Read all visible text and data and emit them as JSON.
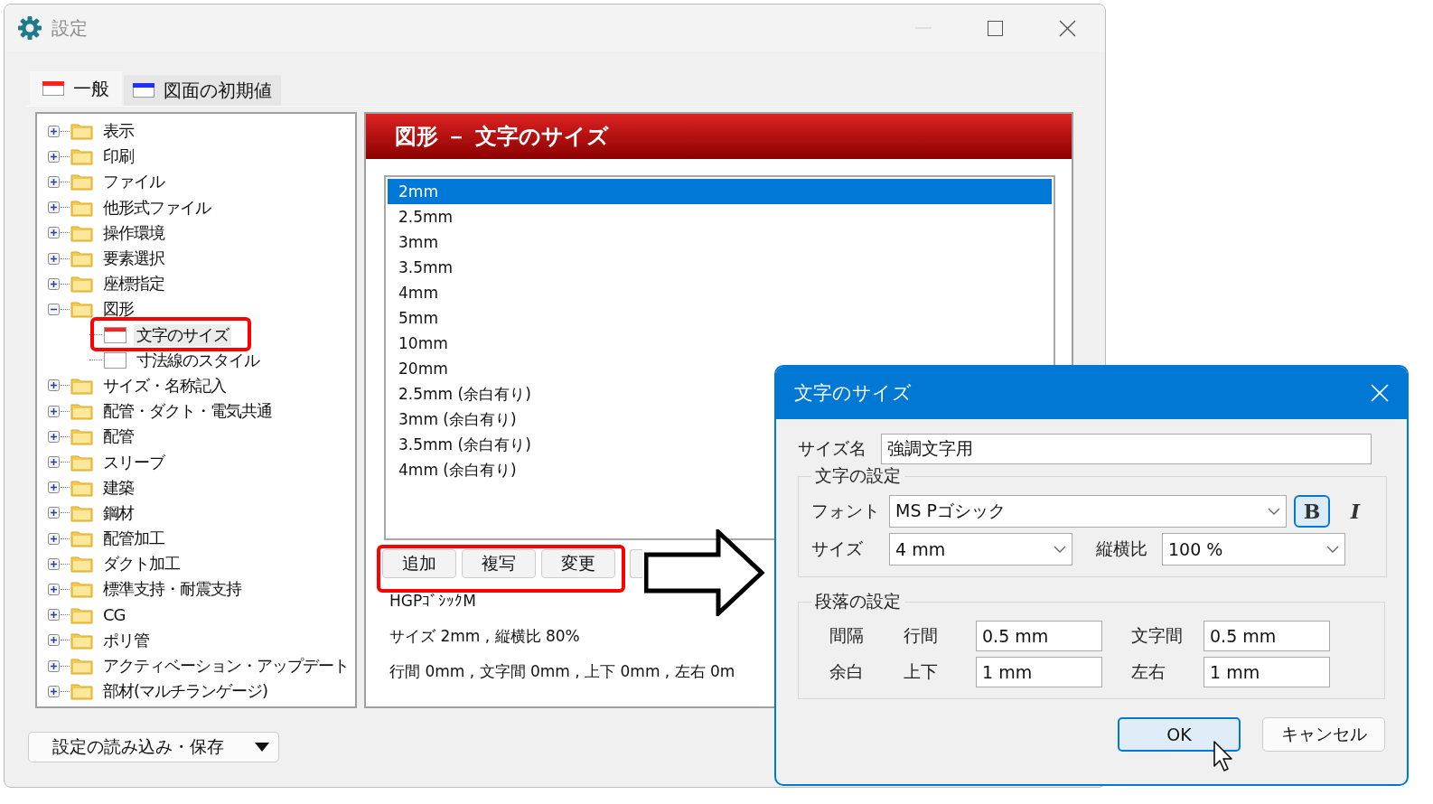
{
  "window": {
    "title": "設定"
  },
  "tabs": [
    {
      "label": "一般",
      "selected": true,
      "color": "#ff2020"
    },
    {
      "label": "図面の初期値",
      "selected": false,
      "color": "#2030ff"
    }
  ],
  "tree": [
    {
      "label": "表示",
      "kind": "folder",
      "expanded": false,
      "selected": false
    },
    {
      "label": "印刷",
      "kind": "folder",
      "expanded": false,
      "selected": false
    },
    {
      "label": "ファイル",
      "kind": "folder",
      "expanded": false,
      "selected": false
    },
    {
      "label": "他形式ファイル",
      "kind": "folder",
      "expanded": false,
      "selected": false
    },
    {
      "label": "操作環境",
      "kind": "folder",
      "expanded": false,
      "selected": false
    },
    {
      "label": "要素選択",
      "kind": "folder",
      "expanded": false,
      "selected": false
    },
    {
      "label": "座標指定",
      "kind": "folder",
      "expanded": false,
      "selected": false
    },
    {
      "label": "図形",
      "kind": "folder",
      "expanded": true,
      "selected": false,
      "children": [
        {
          "label": "文字のサイズ",
          "kind": "page",
          "selected": true
        },
        {
          "label": "寸法線のスタイル",
          "kind": "page",
          "selected": false
        }
      ]
    },
    {
      "label": "サイズ・名称記入",
      "kind": "folder",
      "expanded": false,
      "selected": false
    },
    {
      "label": "配管・ダクト・電気共通",
      "kind": "folder",
      "expanded": false,
      "selected": false
    },
    {
      "label": "配管",
      "kind": "folder",
      "expanded": false,
      "selected": false
    },
    {
      "label": "スリーブ",
      "kind": "folder",
      "expanded": false,
      "selected": false
    },
    {
      "label": "建築",
      "kind": "folder",
      "expanded": false,
      "selected": false
    },
    {
      "label": "鋼材",
      "kind": "folder",
      "expanded": false,
      "selected": false
    },
    {
      "label": "配管加工",
      "kind": "folder",
      "expanded": false,
      "selected": false
    },
    {
      "label": "ダクト加工",
      "kind": "folder",
      "expanded": false,
      "selected": false
    },
    {
      "label": "標準支持・耐震支持",
      "kind": "folder",
      "expanded": false,
      "selected": false
    },
    {
      "label": "CG",
      "kind": "folder",
      "expanded": false,
      "selected": false
    },
    {
      "label": "ポリ管",
      "kind": "folder",
      "expanded": false,
      "selected": false
    },
    {
      "label": "アクティベーション・アップデート",
      "kind": "folder",
      "expanded": false,
      "selected": false
    },
    {
      "label": "部材(マルチランゲージ)",
      "kind": "folder",
      "expanded": false,
      "selected": false
    }
  ],
  "panel": {
    "title": "図形 － 文字のサイズ",
    "list": [
      {
        "label": "2mm",
        "selected": true
      },
      {
        "label": "2.5mm",
        "selected": false
      },
      {
        "label": "3mm",
        "selected": false
      },
      {
        "label": "3.5mm",
        "selected": false
      },
      {
        "label": "4mm",
        "selected": false
      },
      {
        "label": "5mm",
        "selected": false
      },
      {
        "label": "10mm",
        "selected": false
      },
      {
        "label": "20mm",
        "selected": false
      },
      {
        "label": "2.5mm (余白有り)",
        "selected": false
      },
      {
        "label": "3mm (余白有り)",
        "selected": false
      },
      {
        "label": "3.5mm (余白有り)",
        "selected": false
      },
      {
        "label": "4mm (余白有り)",
        "selected": false
      }
    ],
    "buttons": [
      "追加",
      "複写",
      "変更"
    ],
    "info": [
      "HGPｺﾞｼｯｸM",
      "サイズ 2mm , 縦横比 80%",
      "行間 0mm , 文字間 0mm , 上下 0mm , 左右 0m"
    ]
  },
  "load_save_button": "設定の読み込み・保存",
  "dialog": {
    "title": "文字のサイズ",
    "size_name": {
      "label": "サイズ名",
      "value": "強調文字用"
    },
    "text_group": {
      "title": "文字の設定",
      "font": {
        "label": "フォント",
        "value": "MS Pゴシック"
      },
      "bold": {
        "label": "B",
        "on": true
      },
      "italic": {
        "label": "I",
        "on": false
      },
      "size": {
        "label": "サイズ",
        "value": "4 mm"
      },
      "aspect": {
        "label": "縦横比",
        "value": "100 %"
      }
    },
    "para_group": {
      "title": "段落の設定",
      "rows": [
        {
          "label": "間隔",
          "fields": [
            {
              "label": "行間",
              "value": "0.5 mm"
            },
            {
              "label": "文字間",
              "value": "0.5 mm"
            }
          ]
        },
        {
          "label": "余白",
          "fields": [
            {
              "label": "上下",
              "value": "1 mm"
            },
            {
              "label": "左右",
              "value": "1 mm"
            }
          ]
        }
      ]
    },
    "buttons": [
      {
        "label": "OK",
        "default": true
      },
      {
        "label": "キャンセル",
        "default": false
      }
    ]
  }
}
